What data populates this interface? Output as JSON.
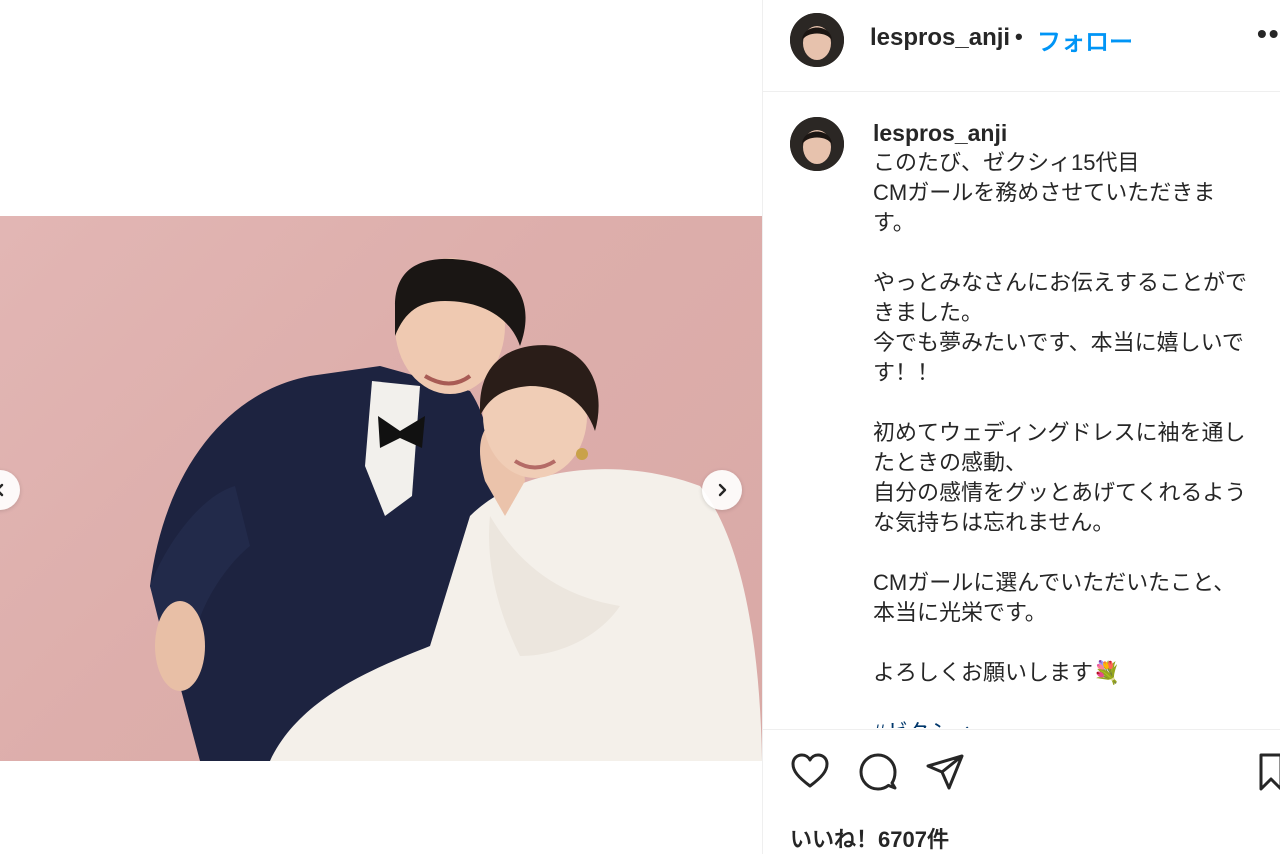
{
  "post": {
    "username": "lespros_anji",
    "dot": "•",
    "follow_label": "フォロー",
    "more_label": "••",
    "caption_username": "lespros_anji",
    "caption_text": "このたび、ゼクシィ15代目\nCMガールを務めさせていただきま\nす。\n\nやっとみなさんにお伝えすることがで\nきました。\n今でも夢みたいです、本当に嬉しいで\nす！！\n\n初めてウェディングドレスに袖を通し\nたときの感動、\n自分の感情をグッとあげてくれるよう\nな気持ちは忘れません。\n\nCMガールに選んでいただいたこと、\n本当に光栄です。\n\nよろしくお願いします💐\n\n",
    "caption_tag": "#ゼクシィ",
    "likes_label": "いいね！6707件"
  },
  "icons": {
    "like": "heart-icon",
    "comment": "comment-icon",
    "share": "share-icon",
    "save": "bookmark-icon",
    "prev": "chevron-left-icon",
    "next": "chevron-right-icon"
  },
  "colors": {
    "follow": "#0095f6",
    "photo_bg": "#dcaeab",
    "text": "#262626"
  }
}
